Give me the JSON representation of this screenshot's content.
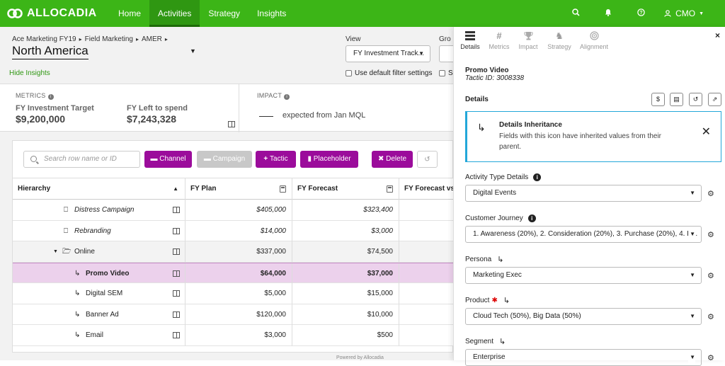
{
  "topnav": {
    "brand": "ALLOCADIA",
    "items": [
      {
        "label": "Home",
        "active": false
      },
      {
        "label": "Activities",
        "active": true
      },
      {
        "label": "Strategy",
        "active": false
      },
      {
        "label": "Insights",
        "active": false
      }
    ],
    "user": "CMO",
    "icons": [
      "search-icon",
      "bell-icon",
      "help-icon",
      "user-icon"
    ]
  },
  "header": {
    "breadcrumb": [
      "Ace Marketing FY19",
      "Field Marketing",
      "AMER"
    ],
    "region": "North America",
    "view_label": "View",
    "view_value": "FY Investment Track...",
    "group_label": "Gro",
    "default_filter_label": "Use default filter settings",
    "second_check_label": "S",
    "hide_insights": "Hide Insights"
  },
  "metrics": {
    "metrics_header": "METRICS",
    "impact_header": "IMPACT",
    "items": [
      {
        "label": "FY Investment Target",
        "value": "$9,200,000"
      },
      {
        "label": "FY Left to spend",
        "value": "$7,243,328"
      }
    ],
    "impact_text": "expected from Jan MQL"
  },
  "toolbar": {
    "search_placeholder": "Search row name or ID",
    "channel": "Channel",
    "campaign": "Campaign",
    "tactic": "Tactic",
    "placeholder": "Placeholder",
    "delete": "Delete"
  },
  "table": {
    "columns": [
      "Hierarchy",
      "FY Plan",
      "FY Forecast",
      "FY Forecast vs"
    ],
    "rows": [
      {
        "name": "Distress Campaign",
        "plan": "$405,000",
        "forecast": "$323,400",
        "type": "campaign"
      },
      {
        "name": "Rebranding",
        "plan": "$14,000",
        "forecast": "$3,000",
        "type": "campaign"
      },
      {
        "name": "Online",
        "plan": "$337,000",
        "forecast": "$74,500",
        "type": "group"
      },
      {
        "name": "Promo Video",
        "plan": "$64,000",
        "forecast": "$37,000",
        "type": "selected"
      },
      {
        "name": "Digital SEM",
        "plan": "$5,000",
        "forecast": "$15,000",
        "type": "tactic"
      },
      {
        "name": "Banner Ad",
        "plan": "$120,000",
        "forecast": "$10,000",
        "type": "tactic"
      },
      {
        "name": "Email",
        "plan": "$3,000",
        "forecast": "$500",
        "type": "tactic"
      }
    ],
    "powered_by": "Powered by Allocadia"
  },
  "panel": {
    "tabs": [
      {
        "label": "Details",
        "icon": "list-icon",
        "active": true
      },
      {
        "label": "Metrics",
        "icon": "hash-icon",
        "active": false
      },
      {
        "label": "Impact",
        "icon": "trophy-icon",
        "active": false
      },
      {
        "label": "Strategy",
        "icon": "chess-icon",
        "active": false
      },
      {
        "label": "Alignment",
        "icon": "target-icon",
        "active": false
      }
    ],
    "title": "Promo Video",
    "tactic_id": "Tactic ID: 3008338",
    "section": "Details",
    "notice_title": "Details Inheritance",
    "notice_body": "Fields with this icon have inherited values from their parent.",
    "fields": [
      {
        "label": "Activity Type Details",
        "value": "Digital Events"
      },
      {
        "label": "Customer Journey",
        "value": "1. Awareness (20%), 2. Consideration (20%), 3. Purchase (20%), 4. E..."
      },
      {
        "label": "Persona",
        "value": "Marketing Exec"
      },
      {
        "label": "Product",
        "value": "Cloud Tech (50%), Big Data (50%)"
      },
      {
        "label": "Segment",
        "value": "Enterprise"
      }
    ]
  }
}
